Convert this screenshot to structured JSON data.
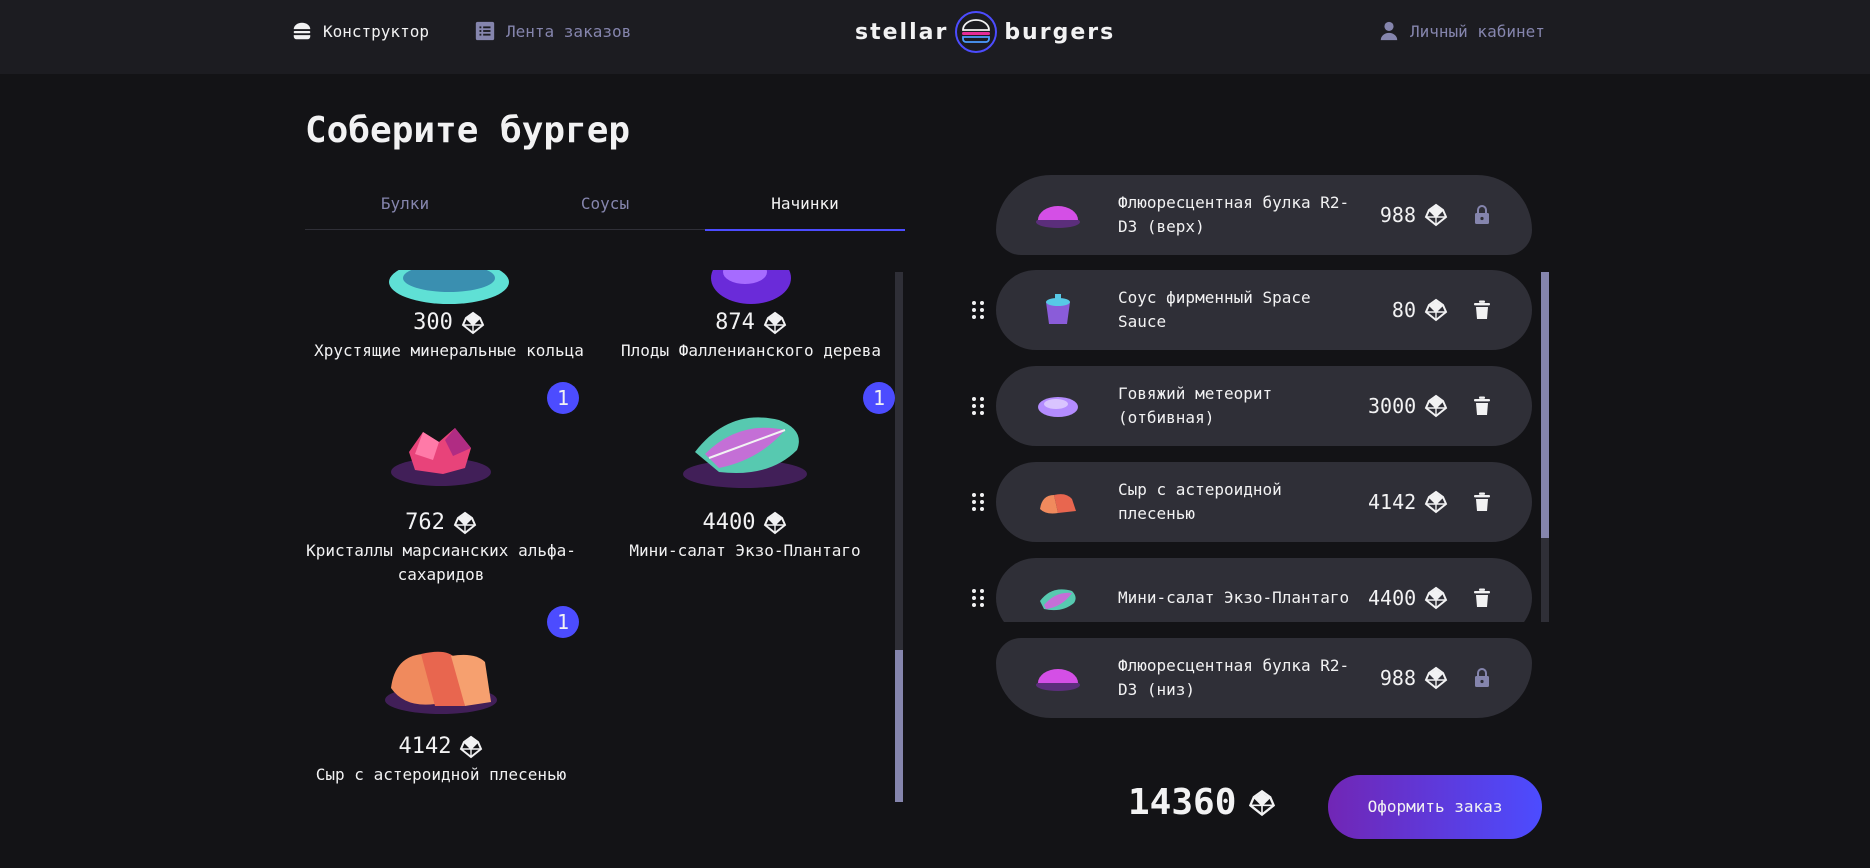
{
  "header": {
    "constructor_label": "Конструктор",
    "feed_label": "Лента заказов",
    "logo_left": "stellar",
    "logo_right": "burgers",
    "profile_label": "Личный кабинет"
  },
  "page_title": "Соберите бургер",
  "tabs": [
    {
      "label": "Булки",
      "active": false
    },
    {
      "label": "Соусы",
      "active": false
    },
    {
      "label": "Начинки",
      "active": true
    }
  ],
  "ingredients": [
    {
      "name": "Хрустящие минеральные кольца",
      "price": "300",
      "count": ""
    },
    {
      "name": "Плоды Фалленианского дерева",
      "price": "874",
      "count": ""
    },
    {
      "name": "Кристаллы марсианских альфа-сахаридов",
      "price": "762",
      "count": "1"
    },
    {
      "name": "Мини-салат Экзо-Плантаго",
      "price": "4400",
      "count": "1"
    },
    {
      "name": "Сыр с астероидной плесенью",
      "price": "4142",
      "count": "1"
    }
  ],
  "constructor": {
    "top_bun": {
      "name": "Флюоресцентная булка R2-D3 (верх)",
      "price": "988"
    },
    "bottom_bun": {
      "name": "Флюоресцентная булка R2-D3 (низ)",
      "price": "988"
    },
    "items": [
      {
        "name": "Соус фирменный Space Sauce",
        "price": "80"
      },
      {
        "name": "Говяжий метеорит (отбивная)",
        "price": "3000"
      },
      {
        "name": "Сыр с астероидной плесенью",
        "price": "4142"
      },
      {
        "name": "Мини-салат Экзо-Плантаго",
        "price": "4400"
      }
    ]
  },
  "total": "14360",
  "order_button": "Оформить заказ",
  "colors": {
    "accent": "#4c4cff",
    "background": "#131316",
    "card": "#2f2f37",
    "inactive": "#8585ad"
  }
}
